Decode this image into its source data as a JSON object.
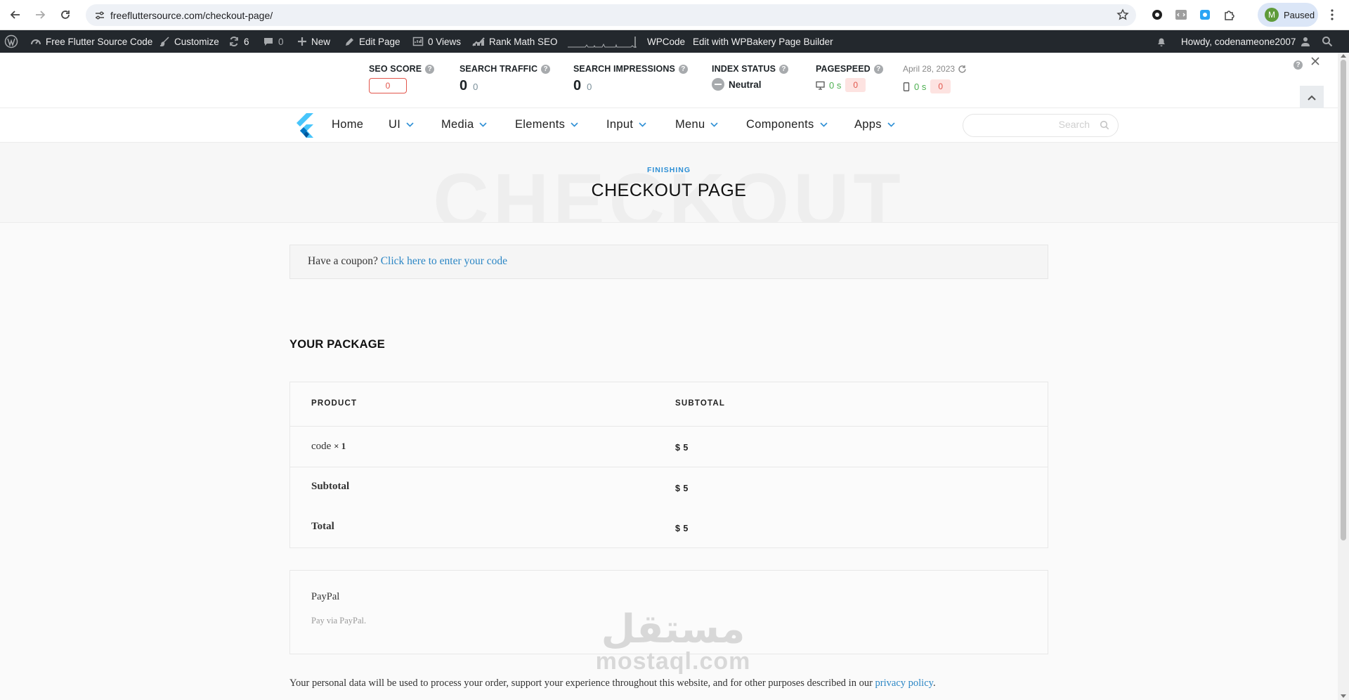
{
  "browser": {
    "url": "freefluttersource.com/checkout-page/",
    "profile_initial": "M",
    "profile_label": "Paused"
  },
  "adminbar": {
    "site_name": "Free Flutter Source Code",
    "customize": "Customize",
    "updates_count": "6",
    "comments_count": "0",
    "new": "New",
    "edit_page": "Edit Page",
    "views": "0 Views",
    "rank_math": "Rank Math SEO",
    "wpcode": "WPCode",
    "wpbakery": "Edit with WPBakery Page Builder",
    "howdy": "Howdy, codenameone2007"
  },
  "rankmath": {
    "seo_score_label": "SEO SCORE",
    "seo_score_value": "0",
    "traffic_label": "SEARCH TRAFFIC",
    "traffic_value": "0",
    "traffic_change": "0",
    "impressions_label": "SEARCH IMPRESSIONS",
    "impressions_value": "0",
    "impressions_change": "0",
    "index_label": "INDEX STATUS",
    "index_value": "Neutral",
    "pagespeed_label": "PAGESPEED",
    "desktop_time": "0 s",
    "desktop_score": "0",
    "mobile_time": "0 s",
    "mobile_score": "0",
    "date": "April 28, 2023"
  },
  "nav": {
    "items": [
      {
        "label": "Home"
      },
      {
        "label": "UI"
      },
      {
        "label": "Media"
      },
      {
        "label": "Elements"
      },
      {
        "label": "Input"
      },
      {
        "label": "Menu"
      },
      {
        "label": "Components"
      },
      {
        "label": "Apps"
      }
    ],
    "search_placeholder": "Search"
  },
  "header": {
    "kicker": "FINISHING",
    "title": "CHECKOUT PAGE",
    "watermark": "CHECKOUT"
  },
  "coupon": {
    "text": "Have a coupon?",
    "link": "Click here to enter your code"
  },
  "package": {
    "heading": "YOUR PACKAGE",
    "col_product": "PRODUCT",
    "col_subtotal": "SUBTOTAL",
    "rows": [
      {
        "label": "code",
        "qty": "× 1",
        "value": "$ 5"
      },
      {
        "label": "Subtotal",
        "value": "$ 5"
      },
      {
        "label": "Total",
        "value": "$ 5"
      }
    ]
  },
  "payment": {
    "method": "PayPal",
    "description": "Pay via PayPal."
  },
  "privacy": {
    "text": "Your personal data will be used to process your order, support your experience throughout this website, and for other purposes described in our",
    "link": "privacy policy",
    "end": "."
  },
  "watermark": {
    "arabic": "مستقل",
    "latin": "mostaql.com"
  }
}
